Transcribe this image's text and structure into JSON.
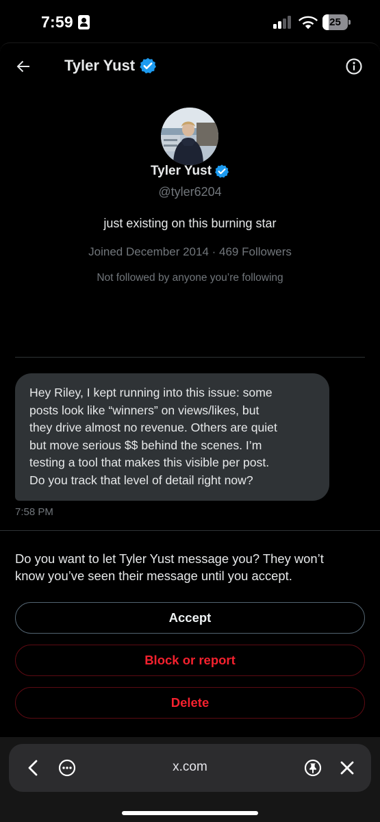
{
  "status_bar": {
    "time": "7:59",
    "battery_level": "25",
    "battery_fraction": 0.25,
    "icons": [
      "contact-card-icon",
      "cellular-signal-icon",
      "wifi-icon",
      "battery-icon"
    ]
  },
  "header": {
    "title": "Tyler Yust",
    "verified": true,
    "back_icon": "arrow-left-icon",
    "info_icon": "info-icon"
  },
  "profile": {
    "name": "Tyler Yust",
    "handle": "@tyler6204",
    "bio": "just existing on this burning star",
    "meta": "Joined December 2014 · 469 Followers",
    "followed_by": "Not followed by anyone you’re following"
  },
  "message": {
    "lines": [
      "Hey Riley, I kept running into this issue: some",
      "posts look like “winners” on views/likes, but",
      "they drive almost no revenue. Others are quiet",
      "but move serious $$ behind the scenes. I’m",
      "testing a tool that makes this visible per post.",
      "Do you track that level of detail right now?"
    ],
    "time": "7:58 PM"
  },
  "request": {
    "prompt_lines": [
      "Do you want to let Tyler Yust message you? They won’t",
      "know you’ve seen their message until you accept."
    ],
    "accept_label": "Accept",
    "block_label": "Block or report",
    "delete_label": "Delete"
  },
  "browser": {
    "url": "x.com",
    "icons": [
      "chevron-left-icon",
      "more-icon",
      "pin-icon",
      "close-icon"
    ]
  },
  "colors": {
    "background": "#000000",
    "accent_blue": "#1d9bf0",
    "danger_red": "#f4212e",
    "bubble": "#2f3336",
    "muted_text": "#71767b"
  }
}
